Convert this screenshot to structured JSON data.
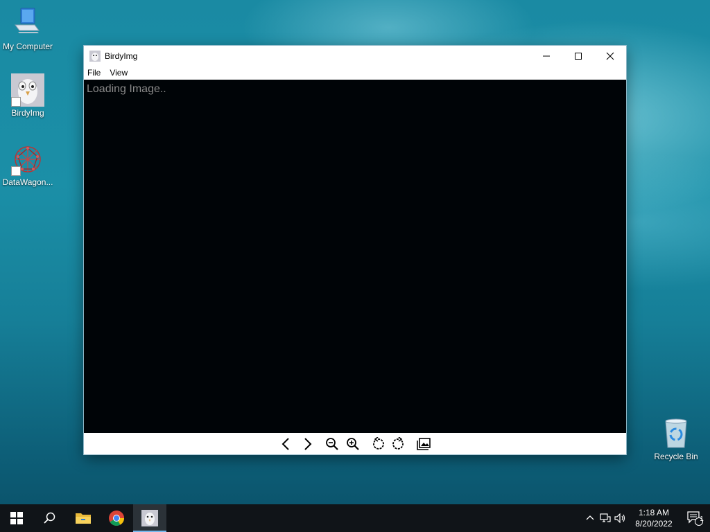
{
  "desktop": {
    "icons": [
      {
        "label": "My Computer",
        "icon": "computer-icon"
      },
      {
        "label": "BirdyImg",
        "icon": "birdyimg-icon"
      },
      {
        "label": "DataWagon...",
        "icon": "datawagon-icon"
      },
      {
        "label": "Recycle Bin",
        "icon": "recycle-bin-icon"
      }
    ]
  },
  "window": {
    "title": "BirdyImg",
    "menu": [
      "File",
      "View"
    ],
    "viewer": {
      "status_text": "Loading Image.."
    },
    "toolbar": [
      {
        "name": "previous",
        "icon": "chevron-left-icon"
      },
      {
        "name": "next",
        "icon": "chevron-right-icon"
      },
      {
        "name": "zoom-out",
        "icon": "zoom-out-icon"
      },
      {
        "name": "zoom-in",
        "icon": "zoom-in-icon"
      },
      {
        "name": "rotate-left",
        "icon": "rotate-left-icon"
      },
      {
        "name": "rotate-right",
        "icon": "rotate-right-icon"
      },
      {
        "name": "gallery",
        "icon": "gallery-icon"
      }
    ]
  },
  "taskbar": {
    "clock": {
      "time": "1:18 AM",
      "date": "8/20/2022"
    },
    "notification_count": "1"
  },
  "colors": {
    "viewer_bg": "#000407",
    "taskbar_bg": "#101418",
    "active_indicator": "#76b9ed"
  }
}
